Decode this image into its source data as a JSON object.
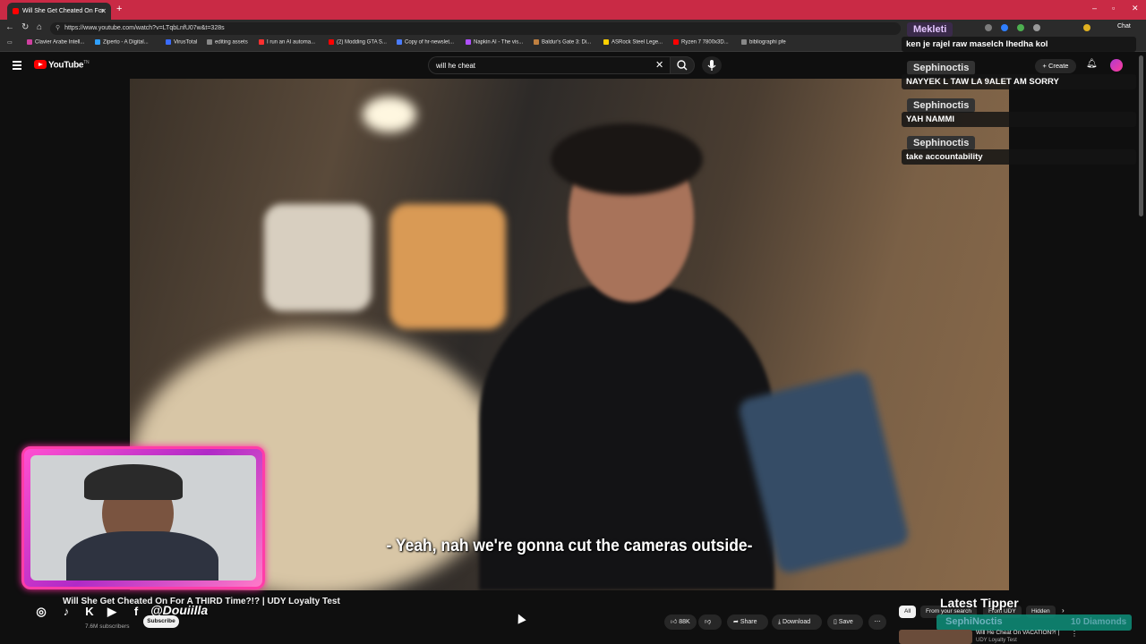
{
  "browser": {
    "tab_title": "Will She Get Cheated On For",
    "url": "https://www.youtube.com/watch?v=LTqbLnfU07w&t=328s",
    "bookmarks": [
      "Clavier Arabe Intell...",
      "Ziperto - A Digital...",
      "VirusTotal",
      "editing assets",
      "I run an AI automa...",
      "(2) Modding GTA S...",
      "Copy of hr-newslet...",
      "Napkin AI - The vis...",
      "Baldur's Gate 3: Di...",
      "ASRock Steel Lege...",
      "Ryzen 7 7800x3D...",
      "bibliographi pfe"
    ],
    "chat_ext_label": "Chat"
  },
  "youtube": {
    "logo_text": "YouTube",
    "logo_region": "TN",
    "search_value": "will he cheat",
    "create_label": "Create"
  },
  "video": {
    "caption": "- Yeah, nah we're gonna cut the cameras outside-",
    "title": "Will She Get Cheated On For A THIRD Time?!? | UDY Loyalty Test",
    "subscribers": "7.6M subscribers",
    "subscribe_label": "Subscribe",
    "likes": "88K",
    "share_label": "Share",
    "download_label": "Download",
    "save_label": "Save"
  },
  "overlay": {
    "handle": "@Douiilla",
    "chat": [
      {
        "user": "Mekleti",
        "message": "ken je rajel raw maselch lhedha kol"
      },
      {
        "user": "Sephinoctis",
        "message": "NAYYEK L TAW LA 9ALET AM SORRY"
      },
      {
        "user": "Sephinoctis",
        "message": "YAH NAMMI"
      },
      {
        "user": "Sephinoctis",
        "message": "take accountability"
      }
    ],
    "latest_tipper_label": "Latest Tipper",
    "tipper_name": "SephiNoctis",
    "tipper_amount": "10 Diamonds"
  },
  "recommendations": {
    "chips": [
      "All",
      "From your search",
      "From UDY",
      "Hidden"
    ],
    "first_title": "Will He Cheat On VACATION?! |",
    "first_channel": "UDY Loyalty Test"
  },
  "colors": {
    "tab_bar": "#c92a45",
    "cam_border": "#ff3da8",
    "youtube_red": "#ff0000"
  }
}
